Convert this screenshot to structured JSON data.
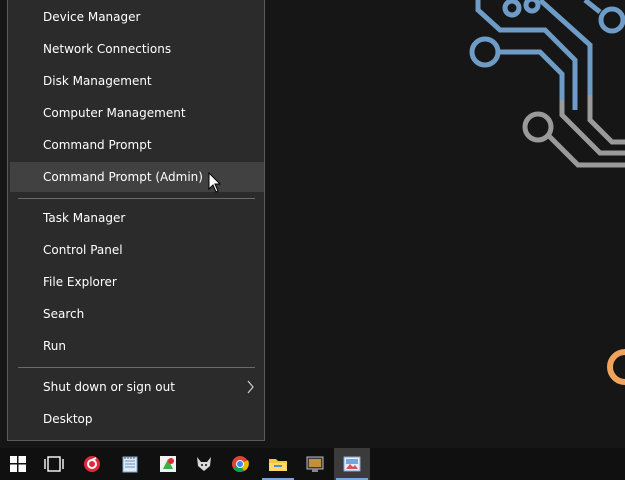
{
  "menu": {
    "items": [
      {
        "label": "Device Manager"
      },
      {
        "label": "Network Connections"
      },
      {
        "label": "Disk Management"
      },
      {
        "label": "Computer Management"
      },
      {
        "label": "Command Prompt"
      },
      {
        "label": "Command Prompt (Admin)",
        "highlighted": true
      },
      {
        "label": "Task Manager"
      },
      {
        "label": "Control Panel"
      },
      {
        "label": "File Explorer"
      },
      {
        "label": "Search"
      },
      {
        "label": "Run"
      },
      {
        "label": "Shut down or sign out",
        "has_submenu": true
      },
      {
        "label": "Desktop"
      }
    ]
  },
  "taskbar": {
    "buttons": [
      {
        "name": "start-button",
        "icon": "windows-logo-icon"
      },
      {
        "name": "task-view-button",
        "icon": "task-view-icon"
      },
      {
        "name": "app-red-circle",
        "icon": "red-circle-app-icon"
      },
      {
        "name": "app-notepad",
        "icon": "notepad-icon"
      },
      {
        "name": "app-paint",
        "icon": "paint-icon"
      },
      {
        "name": "app-fox",
        "icon": "fox-app-icon"
      },
      {
        "name": "app-chrome",
        "icon": "chrome-icon"
      },
      {
        "name": "app-file-explorer",
        "icon": "folder-icon",
        "open": true
      },
      {
        "name": "app-monitor",
        "icon": "monitor-app-icon"
      },
      {
        "name": "app-image",
        "icon": "image-app-icon",
        "open": true,
        "active": true
      }
    ]
  },
  "colors": {
    "menu_bg": "#2b2b2b",
    "menu_highlight": "#414141",
    "taskbar_bg": "#101010",
    "accent_underline": "#7aa7d6",
    "circuit_blue": "#6e9cc6",
    "circuit_gray": "#9a9a9a",
    "circuit_orange": "#f0a35a"
  }
}
